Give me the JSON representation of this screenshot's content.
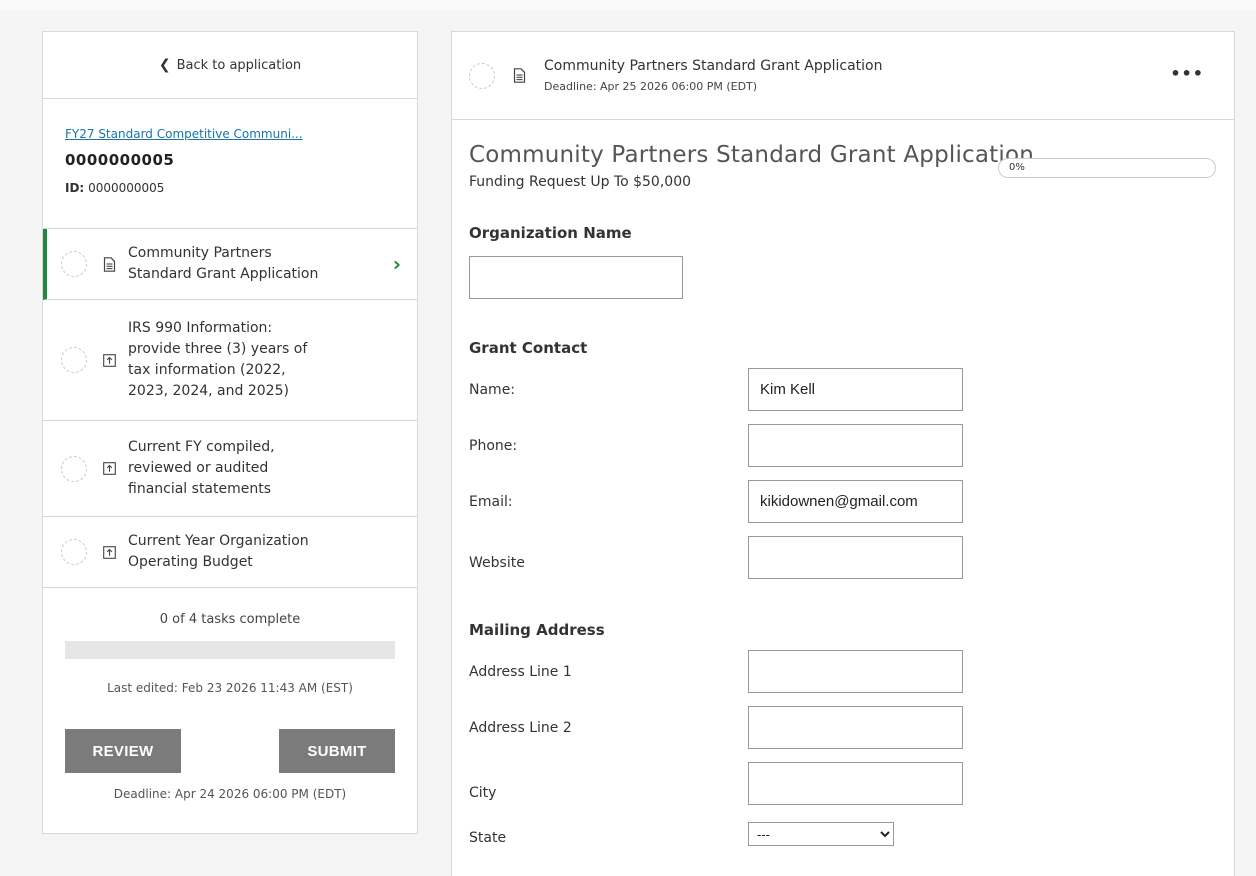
{
  "sidebar": {
    "back_label": "Back to application",
    "app_link": "FY27 Standard Competitive Communi...",
    "app_number": "0000000005",
    "id_label": "ID:",
    "id_value": "0000000005",
    "tasks": [
      {
        "label": "Community Partners Standard Grant Application",
        "icon": "document-icon",
        "active": true
      },
      {
        "label": "IRS 990 Information: provide three (3) years of tax information (2022, 2023, 2024, and 2025)",
        "icon": "upload-icon",
        "active": false
      },
      {
        "label": "Current FY compiled, reviewed or audited financial statements",
        "icon": "upload-icon",
        "active": false
      },
      {
        "label": "Current Year Organization Operating Budget",
        "icon": "upload-icon",
        "active": false
      }
    ],
    "tasks_complete": "0 of 4 tasks complete",
    "tasks_progress": 0,
    "last_edited": "Last edited: Feb 23 2026 11:43 AM (EST)",
    "review_label": "REVIEW",
    "submit_label": "SUBMIT",
    "deadline": "Deadline: Apr 24 2026 06:00 PM (EDT)"
  },
  "header": {
    "title": "Community Partners Standard Grant Application",
    "deadline": "Deadline: Apr 25 2026 06:00 PM (EDT)",
    "more_label": "•••"
  },
  "form": {
    "title": "Community Partners Standard Grant Application",
    "subtitle": "Funding Request Up To $50,000",
    "progress_label": "0%",
    "progress": 0,
    "org_section": "Organization Name",
    "org_value": "",
    "contact_section": "Grant Contact",
    "contact_fields": [
      {
        "label": "Name:",
        "value": "Kim Kell"
      },
      {
        "label": "Phone:",
        "value": ""
      },
      {
        "label": "Email:",
        "value": "kikidownen@gmail.com"
      },
      {
        "label": "Website",
        "value": ""
      }
    ],
    "mailing_section": "Mailing Address",
    "mailing_fields": [
      {
        "label": "Address Line 1",
        "value": ""
      },
      {
        "label": "Address Line 2",
        "value": ""
      },
      {
        "label": "City",
        "value": ""
      }
    ],
    "state_label": "State",
    "state_selected": "---"
  },
  "colors": {
    "accent_green": "#1f8a3b",
    "link_blue": "#1a74a8",
    "button_gray": "#7b7b7b"
  }
}
